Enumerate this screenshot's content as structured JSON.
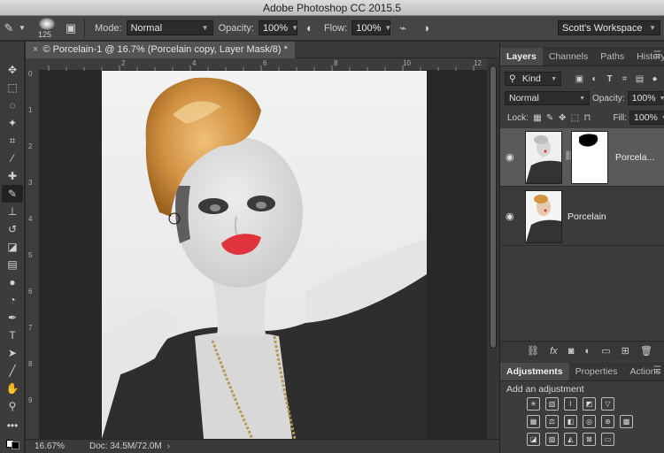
{
  "app": {
    "title": "Adobe Photoshop CC 2015.5"
  },
  "options": {
    "brush_size": "125",
    "mode_label": "Mode:",
    "mode_value": "Normal",
    "opacity_label": "Opacity:",
    "opacity_value": "100%",
    "flow_label": "Flow:",
    "flow_value": "100%",
    "workspace": "Scott's Workspace"
  },
  "document": {
    "tab_title": "© Porcelain-1 @ 16.7% (Porcelain copy, Layer Mask/8) *",
    "zoom": "16.67%",
    "doc_info": "Doc: 34.5M/72.0M"
  },
  "ruler": {
    "top": [
      "2",
      "4",
      "6",
      "8",
      "10",
      "12"
    ],
    "left": [
      "0",
      "1",
      "2",
      "3",
      "4",
      "5",
      "6",
      "7",
      "8",
      "9"
    ]
  },
  "layers_panel": {
    "tabs": [
      "Layers",
      "Channels",
      "Paths",
      "History"
    ],
    "filter_kind": "Kind",
    "blend_mode": "Normal",
    "opacity_label": "Opacity:",
    "opacity_value": "100%",
    "lock_label": "Lock:",
    "fill_label": "Fill:",
    "fill_value": "100%",
    "layers": [
      {
        "name": "Porcela...",
        "selected": true,
        "has_mask": true
      },
      {
        "name": "Porcelain",
        "selected": false,
        "has_mask": false
      }
    ]
  },
  "adjustments_panel": {
    "tabs": [
      "Adjustments",
      "Properties",
      "Actions"
    ],
    "hint": "Add an adjustment"
  },
  "colors": {
    "selected_layer": "#5a5a5a",
    "panel_bg": "#3c3c3c",
    "lip": "#e0333e"
  }
}
